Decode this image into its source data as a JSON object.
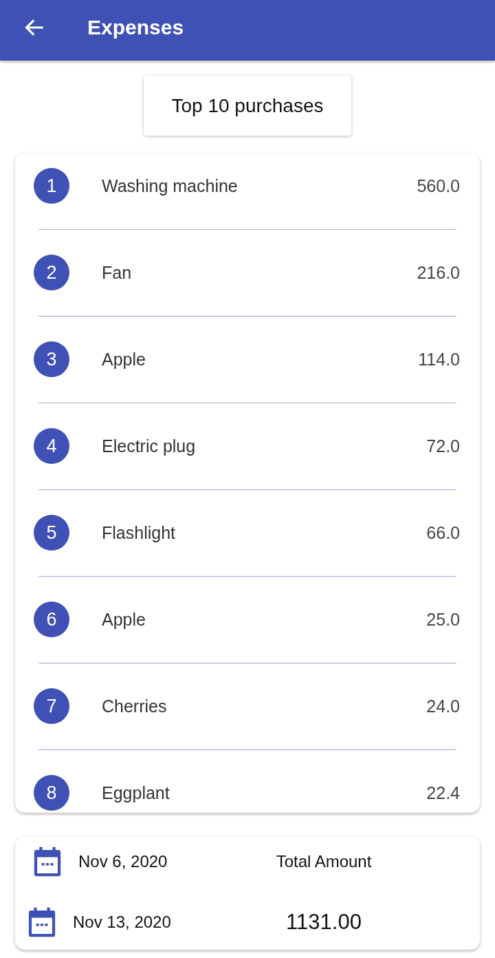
{
  "app_bar": {
    "title": "Expenses"
  },
  "top_button": {
    "label": "Top 10 purchases"
  },
  "purchases": [
    {
      "rank": "1",
      "name": "Washing machine",
      "amount": "560.0"
    },
    {
      "rank": "2",
      "name": "Fan",
      "amount": "216.0"
    },
    {
      "rank": "3",
      "name": "Apple",
      "amount": "114.0"
    },
    {
      "rank": "4",
      "name": "Electric plug",
      "amount": "72.0"
    },
    {
      "rank": "5",
      "name": "Flashlight",
      "amount": "66.0"
    },
    {
      "rank": "6",
      "name": "Apple",
      "amount": "25.0"
    },
    {
      "rank": "7",
      "name": "Cherries",
      "amount": "24.0"
    },
    {
      "rank": "8",
      "name": "Eggplant",
      "amount": "22.4"
    }
  ],
  "summary": {
    "start_date": "Nov 6, 2020",
    "total_label": "Total Amount",
    "end_date": "Nov 13, 2020",
    "total": "1131.00"
  }
}
